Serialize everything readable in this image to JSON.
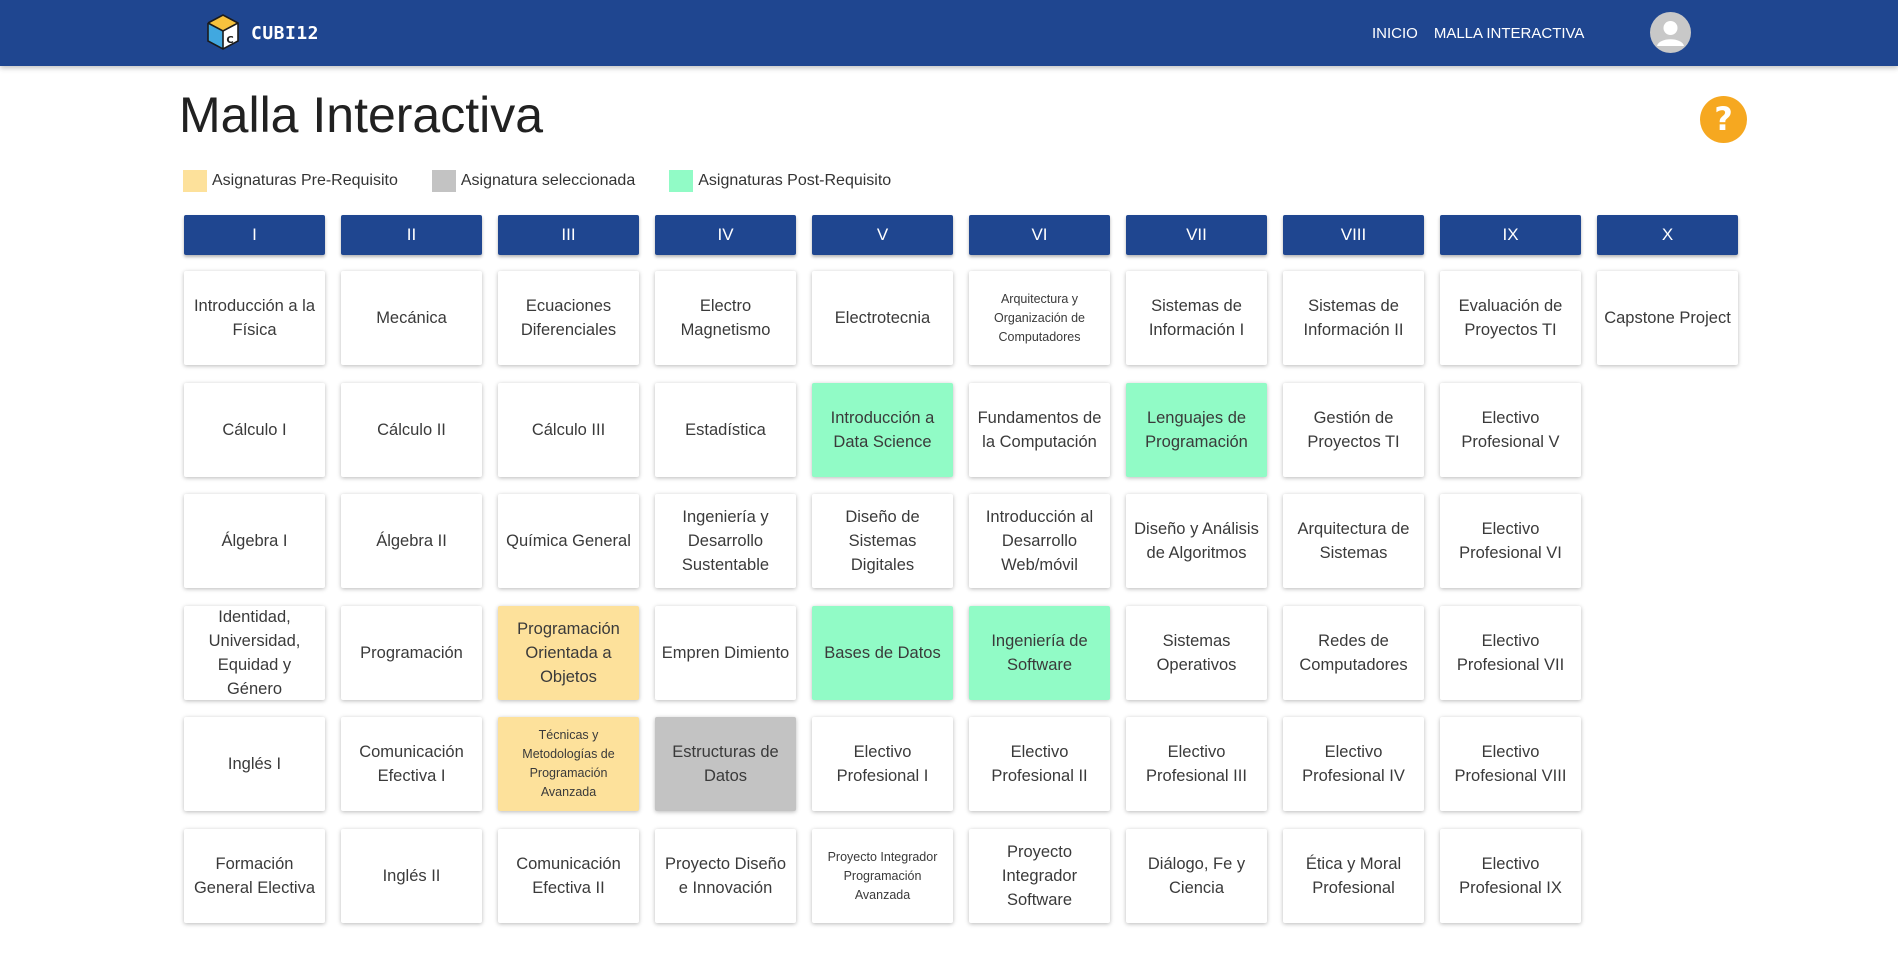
{
  "app": {
    "name": "CUBI12"
  },
  "nav": {
    "inicio": "INICIO",
    "malla": "MALLA INTERACTIVA"
  },
  "page": {
    "title": "Malla Interactiva",
    "help_symbol": "?"
  },
  "legend": {
    "pre": {
      "label": "Asignaturas Pre-Requisito",
      "color": "#fde19b"
    },
    "selected": {
      "label": "Asignatura seleccionada",
      "color": "#c3c3c3"
    },
    "post": {
      "label": "Asignaturas Post-Requisito",
      "color": "#91fbc6"
    }
  },
  "colors": {
    "navbar": "#1f4690",
    "help": "#f6a820",
    "card": "#ffffff"
  },
  "semesters": [
    {
      "label": "I",
      "courses": [
        {
          "name": "Introducción a la Física",
          "state": "none"
        },
        {
          "name": "Cálculo I",
          "state": "none"
        },
        {
          "name": "Álgebra I",
          "state": "none"
        },
        {
          "name": "Identidad, Universidad, Equidad y Género",
          "state": "none"
        },
        {
          "name": "Inglés I",
          "state": "none"
        },
        {
          "name": "Formación General Electiva",
          "state": "none"
        }
      ]
    },
    {
      "label": "II",
      "courses": [
        {
          "name": "Mecánica",
          "state": "none"
        },
        {
          "name": "Cálculo II",
          "state": "none"
        },
        {
          "name": "Álgebra II",
          "state": "none"
        },
        {
          "name": "Programación",
          "state": "none"
        },
        {
          "name": "Comunicación Efectiva I",
          "state": "none"
        },
        {
          "name": "Inglés II",
          "state": "none"
        }
      ]
    },
    {
      "label": "III",
      "courses": [
        {
          "name": "Ecuaciones Diferenciales",
          "state": "none"
        },
        {
          "name": "Cálculo III",
          "state": "none"
        },
        {
          "name": "Química General",
          "state": "none"
        },
        {
          "name": "Programación Orientada a Objetos",
          "state": "pre"
        },
        {
          "name": "Técnicas y Metodologías de Programación Avanzada",
          "state": "pre",
          "small": true
        },
        {
          "name": "Comunicación Efectiva II",
          "state": "none"
        }
      ]
    },
    {
      "label": "IV",
      "courses": [
        {
          "name": "Electro Magnetismo",
          "state": "none"
        },
        {
          "name": "Estadística",
          "state": "none"
        },
        {
          "name": "Ingeniería y Desarrollo Sustentable",
          "state": "none"
        },
        {
          "name": "Empren Dimiento",
          "state": "none"
        },
        {
          "name": "Estructuras de Datos",
          "state": "selected"
        },
        {
          "name": "Proyecto Diseño e Innovación",
          "state": "none"
        }
      ]
    },
    {
      "label": "V",
      "courses": [
        {
          "name": "Electrotecnia",
          "state": "none"
        },
        {
          "name": "Introducción a Data Science",
          "state": "post"
        },
        {
          "name": "Diseño de Sistemas Digitales",
          "state": "none"
        },
        {
          "name": "Bases de Datos",
          "state": "post"
        },
        {
          "name": "Electivo Profesional I",
          "state": "none"
        },
        {
          "name": "Proyecto Integrador Programación Avanzada",
          "state": "none",
          "small": true
        }
      ]
    },
    {
      "label": "VI",
      "courses": [
        {
          "name": "Arquitectura y Organización de Computadores",
          "state": "none",
          "small": true
        },
        {
          "name": "Fundamentos de la Computación",
          "state": "none"
        },
        {
          "name": "Introducción al Desarrollo Web/móvil",
          "state": "none"
        },
        {
          "name": "Ingeniería de Software",
          "state": "post"
        },
        {
          "name": "Electivo Profesional II",
          "state": "none"
        },
        {
          "name": "Proyecto Integrador Software",
          "state": "none"
        }
      ]
    },
    {
      "label": "VII",
      "courses": [
        {
          "name": "Sistemas de Información I",
          "state": "none"
        },
        {
          "name": "Lenguajes de Programación",
          "state": "post"
        },
        {
          "name": "Diseño y Análisis de Algoritmos",
          "state": "none"
        },
        {
          "name": "Sistemas Operativos",
          "state": "none"
        },
        {
          "name": "Electivo Profesional III",
          "state": "none"
        },
        {
          "name": "Diálogo, Fe y Ciencia",
          "state": "none"
        }
      ]
    },
    {
      "label": "VIII",
      "courses": [
        {
          "name": "Sistemas de Información II",
          "state": "none"
        },
        {
          "name": "Gestión de Proyectos TI",
          "state": "none"
        },
        {
          "name": "Arquitectura de Sistemas",
          "state": "none"
        },
        {
          "name": "Redes de Computadores",
          "state": "none"
        },
        {
          "name": "Electivo Profesional IV",
          "state": "none"
        },
        {
          "name": "Ética y Moral Profesional",
          "state": "none"
        }
      ]
    },
    {
      "label": "IX",
      "courses": [
        {
          "name": "Evaluación de Proyectos TI",
          "state": "none"
        },
        {
          "name": "Electivo Profesional V",
          "state": "none"
        },
        {
          "name": "Electivo Profesional VI",
          "state": "none"
        },
        {
          "name": "Electivo Profesional VII",
          "state": "none"
        },
        {
          "name": "Electivo Profesional VIII",
          "state": "none"
        },
        {
          "name": "Electivo Profesional IX",
          "state": "none"
        }
      ]
    },
    {
      "label": "X",
      "courses": [
        {
          "name": "Capstone Project",
          "state": "none"
        }
      ]
    }
  ]
}
